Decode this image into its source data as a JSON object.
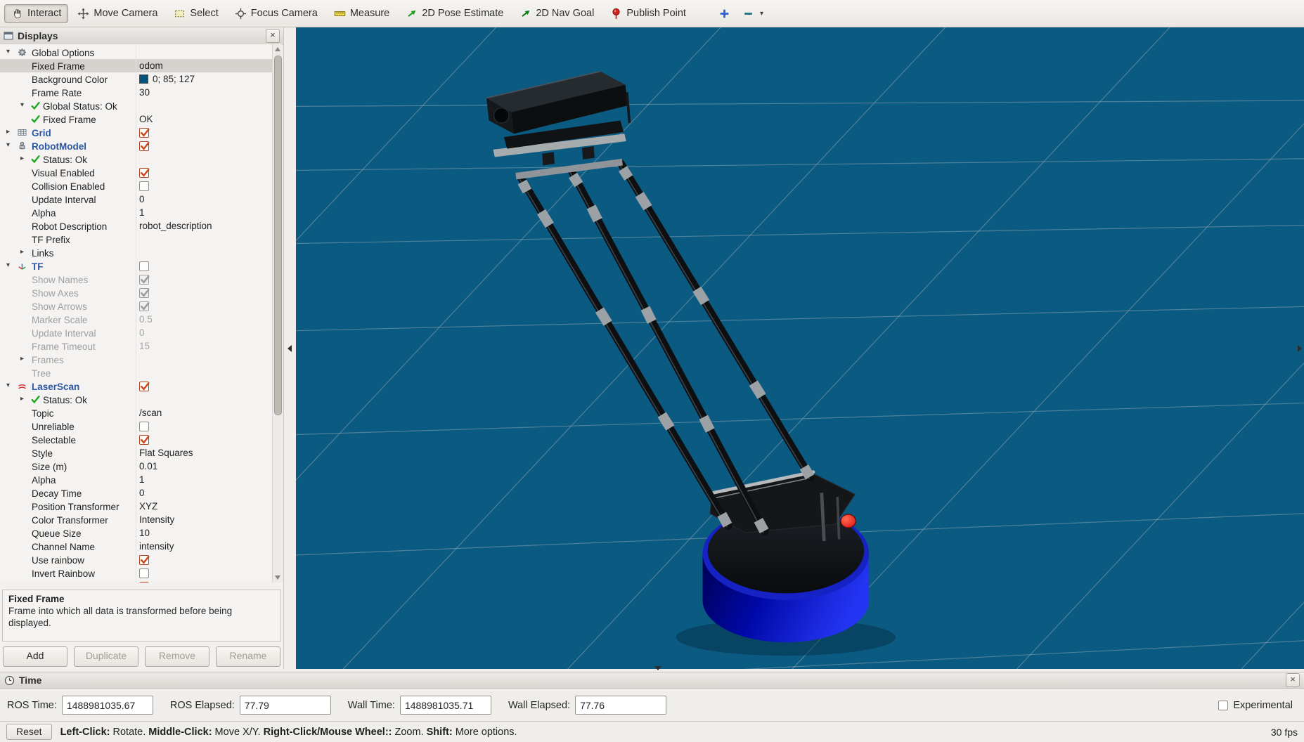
{
  "toolbar": {
    "tools": [
      {
        "name": "interact",
        "label": "Interact",
        "active": true
      },
      {
        "name": "move-camera",
        "label": "Move Camera",
        "active": false
      },
      {
        "name": "select",
        "label": "Select",
        "active": false
      },
      {
        "name": "focus-camera",
        "label": "Focus Camera",
        "active": false
      },
      {
        "name": "measure",
        "label": "Measure",
        "active": false
      },
      {
        "name": "pose-estimate",
        "label": "2D Pose Estimate",
        "active": false
      },
      {
        "name": "nav-goal",
        "label": "2D Nav Goal",
        "active": false
      },
      {
        "name": "publish-point",
        "label": "Publish Point",
        "active": false
      }
    ],
    "icon_buttons": [
      {
        "name": "add-tool",
        "icon": "plus"
      },
      {
        "name": "remove-tool",
        "icon": "minus",
        "caret": true
      }
    ]
  },
  "displays_panel": {
    "title": "Displays",
    "rows": [
      {
        "c": "top",
        "a": "down",
        "i": "gear",
        "l": "Global Options"
      },
      {
        "c": "prop",
        "l": "Fixed Frame",
        "sel": true,
        "v": {
          "t": "odom"
        }
      },
      {
        "c": "prop",
        "l": "Background Color",
        "v": {
          "sw": "#00557f",
          "t": "0; 85; 127"
        }
      },
      {
        "c": "prop",
        "l": "Frame Rate",
        "v": {
          "t": "30"
        }
      },
      {
        "c": "status",
        "a": "down",
        "i": "check",
        "l": "Global Status: Ok"
      },
      {
        "c": "sub",
        "i": "check",
        "l": "Fixed Frame",
        "v": {
          "t": "OK"
        }
      },
      {
        "c": "top",
        "a": "right",
        "i": "grid",
        "l": "Grid",
        "s": "name",
        "v": {
          "cb": "on"
        }
      },
      {
        "c": "top",
        "a": "down",
        "i": "robot",
        "l": "RobotModel",
        "s": "name",
        "v": {
          "cb": "on"
        }
      },
      {
        "c": "status",
        "a": "right",
        "i": "check",
        "l": "Status: Ok"
      },
      {
        "c": "prop",
        "l": "Visual Enabled",
        "v": {
          "cb": "on"
        }
      },
      {
        "c": "prop",
        "l": "Collision Enabled",
        "v": {
          "cb": "off"
        }
      },
      {
        "c": "prop",
        "l": "Update Interval",
        "v": {
          "t": "0"
        }
      },
      {
        "c": "prop",
        "l": "Alpha",
        "v": {
          "t": "1"
        }
      },
      {
        "c": "prop",
        "l": "Robot Description",
        "v": {
          "t": "robot_description"
        }
      },
      {
        "c": "prop",
        "l": "TF Prefix"
      },
      {
        "c": "parrow",
        "a": "right",
        "l": "Links"
      },
      {
        "c": "top",
        "a": "down",
        "i": "tf",
        "l": "TF",
        "s": "name",
        "v": {
          "cb": "off"
        }
      },
      {
        "c": "prop",
        "l": "Show Names",
        "s": "gray",
        "v": {
          "cb": "gray"
        }
      },
      {
        "c": "prop",
        "l": "Show Axes",
        "s": "gray",
        "v": {
          "cb": "gray"
        }
      },
      {
        "c": "prop",
        "l": "Show Arrows",
        "s": "gray",
        "v": {
          "cb": "gray"
        }
      },
      {
        "c": "prop",
        "l": "Marker Scale",
        "s": "gray",
        "v": {
          "t": "0.5",
          "g": 1
        }
      },
      {
        "c": "prop",
        "l": "Update Interval",
        "s": "gray",
        "v": {
          "t": "0",
          "g": 1
        }
      },
      {
        "c": "prop",
        "l": "Frame Timeout",
        "s": "gray",
        "v": {
          "t": "15",
          "g": 1
        }
      },
      {
        "c": "parrow",
        "a": "right",
        "l": "Frames",
        "s": "gray"
      },
      {
        "c": "prop",
        "l": "Tree",
        "s": "gray"
      },
      {
        "c": "top",
        "a": "down",
        "i": "laser",
        "l": "LaserScan",
        "s": "name",
        "v": {
          "cb": "on"
        }
      },
      {
        "c": "status",
        "a": "right",
        "i": "check",
        "l": "Status: Ok"
      },
      {
        "c": "prop",
        "l": "Topic",
        "v": {
          "t": "/scan"
        }
      },
      {
        "c": "prop",
        "l": "Unreliable",
        "v": {
          "cb": "off"
        }
      },
      {
        "c": "prop",
        "l": "Selectable",
        "v": {
          "cb": "on"
        }
      },
      {
        "c": "prop",
        "l": "Style",
        "v": {
          "t": "Flat Squares"
        }
      },
      {
        "c": "prop",
        "l": "Size (m)",
        "v": {
          "t": "0.01"
        }
      },
      {
        "c": "prop",
        "l": "Alpha",
        "v": {
          "t": "1"
        }
      },
      {
        "c": "prop",
        "l": "Decay Time",
        "v": {
          "t": "0"
        }
      },
      {
        "c": "prop",
        "l": "Position Transformer",
        "v": {
          "t": "XYZ"
        }
      },
      {
        "c": "prop",
        "l": "Color Transformer",
        "v": {
          "t": "Intensity"
        }
      },
      {
        "c": "prop",
        "l": "Queue Size",
        "v": {
          "t": "10"
        }
      },
      {
        "c": "prop",
        "l": "Channel Name",
        "v": {
          "t": "intensity"
        }
      },
      {
        "c": "prop",
        "l": "Use rainbow",
        "v": {
          "cb": "on"
        }
      },
      {
        "c": "prop",
        "l": "Invert Rainbow",
        "v": {
          "cb": "off"
        }
      },
      {
        "c": "prop",
        "l": "",
        "v": {
          "cb": "on"
        }
      }
    ],
    "help": {
      "title": "Fixed Frame",
      "body": "Frame into which all data is transformed before being displayed."
    },
    "buttons": {
      "add": "Add",
      "duplicate": "Duplicate",
      "remove": "Remove",
      "rename": "Rename"
    }
  },
  "time_panel": {
    "title": "Time",
    "fields": [
      {
        "label": "ROS Time:",
        "value": "1488981035.67"
      },
      {
        "label": "ROS Elapsed:",
        "value": "77.79"
      },
      {
        "label": "Wall Time:",
        "value": "1488981035.71"
      },
      {
        "label": "Wall Elapsed:",
        "value": "77.76"
      }
    ],
    "experimental_label": "Experimental"
  },
  "statusbar": {
    "reset_label": "Reset",
    "segments": [
      {
        "b": "Left-Click:",
        "t": " Rotate.  "
      },
      {
        "b": "Middle-Click:",
        "t": " Move X/Y.  "
      },
      {
        "b": "Right-Click/Mouse Wheel::",
        "t": " Zoom.  "
      },
      {
        "b": "Shift:",
        "t": " More options."
      }
    ],
    "fps": "30 fps"
  },
  "viewport": {
    "background_color": "#0b5a81",
    "grid_color": "#93a9b4",
    "base_color": "#1c2ae0",
    "base_dark_color": "#000055",
    "button_color": "#e01818"
  }
}
